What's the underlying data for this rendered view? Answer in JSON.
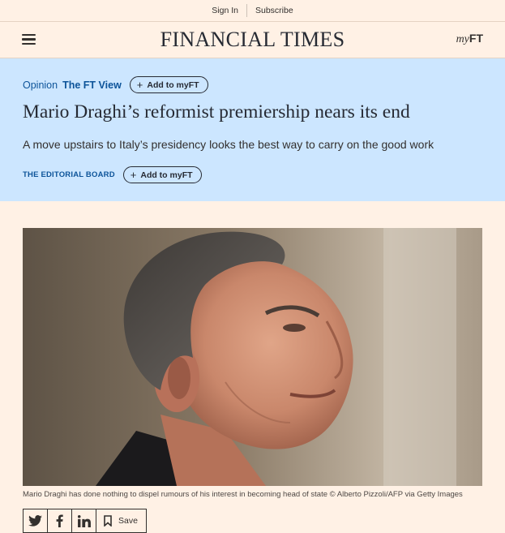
{
  "topbar": {
    "sign_in": "Sign In",
    "subscribe": "Subscribe"
  },
  "header": {
    "logo": "FINANCIAL TIMES",
    "myft_my": "my",
    "myft_ft": "FT"
  },
  "article": {
    "section": "Opinion",
    "series": "The FT View",
    "follow_label": "Add to myFT",
    "headline": "Mario Draghi’s reformist premiership nears its end",
    "standfirst": "A move upstairs to Italy’s presidency looks the best way to carry on the good work",
    "author": "THE EDITORIAL BOARD",
    "author_follow_label": "Add to myFT",
    "caption": "Mario Draghi has done nothing to dispel rumours of his interest in becoming head of state © Alberto Pizzoli/AFP via Getty Images"
  },
  "share": {
    "save_label": "Save",
    "icons": [
      "twitter-icon",
      "facebook-icon",
      "linkedin-icon",
      "bookmark-icon"
    ]
  },
  "colors": {
    "page_bg": "#fff1e5",
    "hero_bg": "#cce6ff",
    "link_blue": "#0d5499",
    "text_dark": "#262a33"
  }
}
